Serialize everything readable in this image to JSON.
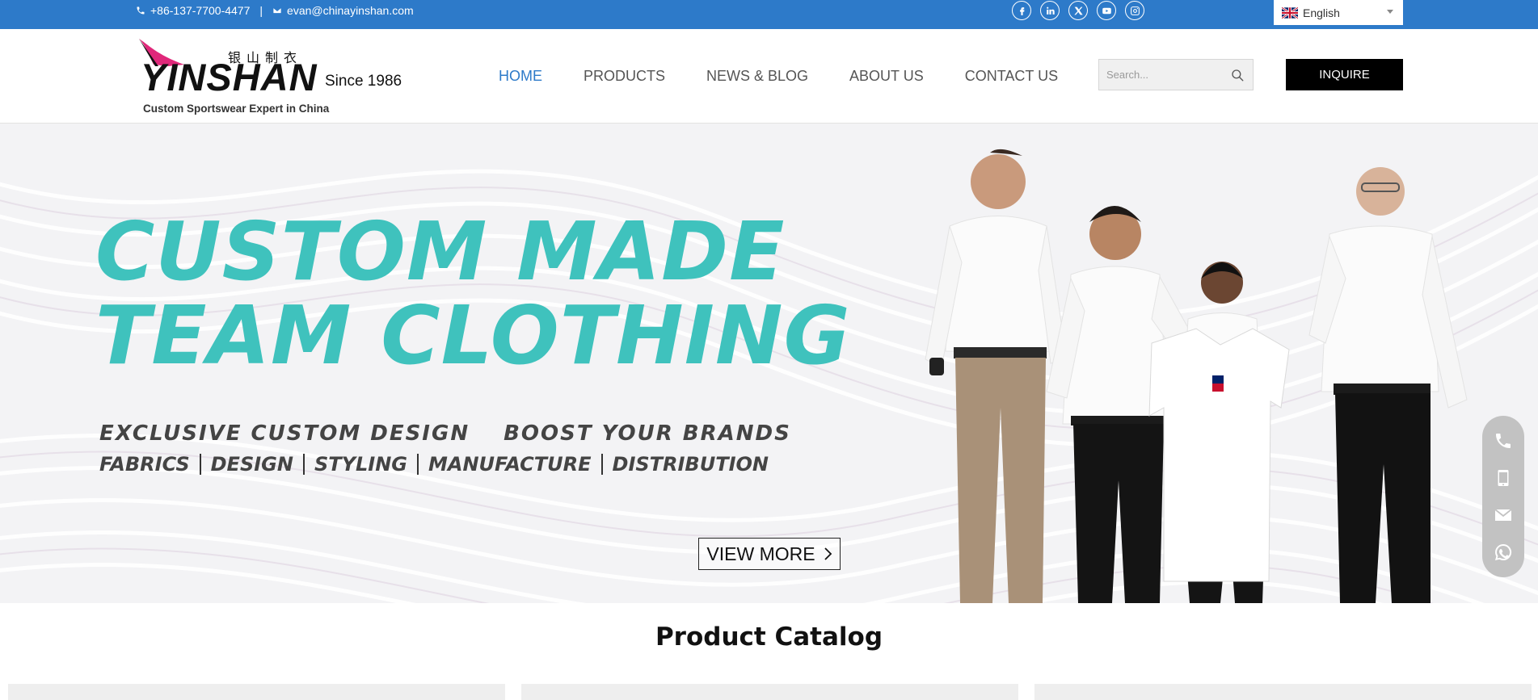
{
  "topbar": {
    "phone": "+86-137-7700-4477",
    "separator": "|",
    "email": "evan@chinayinshan.com",
    "socials": [
      "facebook-icon",
      "linkedin-icon",
      "x-twitter-icon",
      "youtube-icon",
      "instagram-icon"
    ],
    "language": "English",
    "bg_color": "#2d7ac9"
  },
  "header": {
    "logo_wordmark": "YINSHAN",
    "logo_chinese": "银山制衣",
    "logo_since": "Since 1986",
    "logo_tagline": "Custom Sportswear Expert in China",
    "nav": [
      {
        "label": "HOME",
        "active": true
      },
      {
        "label": "PRODUCTS",
        "active": false
      },
      {
        "label": "NEWS & BLOG",
        "active": false
      },
      {
        "label": "ABOUT US",
        "active": false
      },
      {
        "label": "CONTACT US",
        "active": false
      }
    ],
    "search_placeholder": "Search...",
    "inquire_label": "INQUIRE"
  },
  "hero": {
    "title_line1": "CUSTOM MADE",
    "title_line2": "TEAM CLOTHING",
    "subtitle_a": "EXCLUSIVE CUSTOM DESIGN",
    "subtitle_b": "BOOST YOUR BRANDS",
    "services": [
      "FABRICS",
      "DESIGN",
      "STYLING",
      "MANUFACTURE",
      "DISTRIBUTION"
    ],
    "cta_label": "VIEW MORE",
    "accent_color": "#3fc2bd"
  },
  "floating_contact": [
    "phone-icon",
    "mobile-icon",
    "mail-icon",
    "whatsapp-icon"
  ],
  "catalog": {
    "title": "Product Catalog"
  }
}
